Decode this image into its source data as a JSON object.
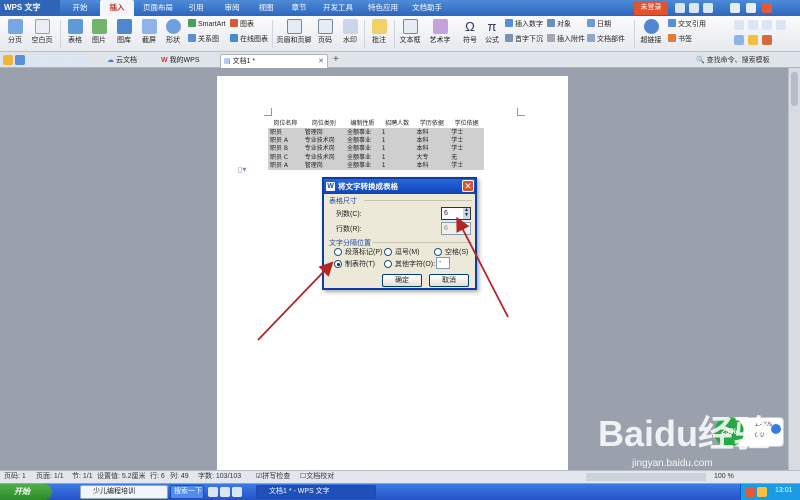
{
  "app": {
    "title": "WPS 文字",
    "login": "未登录"
  },
  "menu": [
    "开始",
    "插入",
    "页面布局",
    "引用",
    "审阅",
    "视图",
    "章节",
    "开发工具",
    "特色应用",
    "文档助手"
  ],
  "menu_active": "插入",
  "ribbon": {
    "page_break": "分页",
    "blank_page": "空白页",
    "table": "表格",
    "picture": "图片",
    "gallery": "图库",
    "screenshot": "截屏",
    "shape": "形状",
    "smartart": "SmartArt",
    "chart": "图表",
    "relation": "关系图",
    "online_chart": "在线图表",
    "header_footer": "页眉和页脚",
    "page_number": "页码",
    "watermark": "水印",
    "comment": "批注",
    "textbox": "文本框",
    "wordart": "艺术字",
    "symbol": "符号",
    "formula": "公式",
    "insert_number": "插入数字",
    "object": "对象",
    "first_drop": "首字下沉",
    "attach": "插入附件",
    "date": "日期",
    "doc_parts": "文档部件",
    "hyperlink": "超链接",
    "bookmark": "书签",
    "crossref": "交叉引用"
  },
  "tabs": {
    "cloud": "云文档",
    "my_wps": "我的WPS",
    "doc": "文档1 *",
    "search": "查找命令、搜索模板"
  },
  "doc_table": {
    "headers": [
      "岗位名称",
      "岗位类别",
      "编制性质",
      "招聘人数",
      "学历依据",
      "学位依据"
    ],
    "rows": [
      [
        "职员",
        "管理岗",
        "全额事业",
        "1",
        "本科",
        "学士"
      ],
      [
        "职员 A",
        "专业技术岗",
        "全额事业",
        "1",
        "本科",
        "学士"
      ],
      [
        "职员 B",
        "专业技术岗",
        "全额事业",
        "1",
        "本科",
        "学士"
      ],
      [
        "职员 C",
        "专业技术岗",
        "全额事业",
        "1",
        "大专",
        "无"
      ],
      [
        "职员 A",
        "管理岗",
        "全额事业",
        "1",
        "本科",
        "学士"
      ]
    ]
  },
  "dialog": {
    "title": "将文字转换成表格",
    "size_group": "表格尺寸",
    "cols_label": "列数(C):",
    "cols_value": "6",
    "rows_label": "行数(R):",
    "rows_value": "6",
    "sep_group": "文字分隔位置",
    "opt_para": "段落标记(P)",
    "opt_comma": "逗号(M)",
    "opt_space": "空格(S)",
    "opt_tab": "制表符(T)",
    "opt_other": "其他字符(O):",
    "other_value": "-",
    "ok": "确定",
    "cancel": "取消",
    "selected_option": "opt_tab"
  },
  "status": {
    "pages": "页码: 1",
    "page_of": "页面: 1/1",
    "section": "节: 1/1",
    "position": "设置值: 5.2厘米",
    "row": "行: 6",
    "col": "列: 49",
    "chars": "字数: 103/103",
    "spell": "拼写检查",
    "proof": "文档校对",
    "zoom": "100 %"
  },
  "taskbar": {
    "start": "开始",
    "item1": "少儿编程培训",
    "item2": "搜索一下",
    "item3": "文档1 * - WPS 文字",
    "clock": "13:01"
  },
  "speed": {
    "percent": "25%",
    "up": "1.4K/s",
    "down": "0K/s"
  },
  "watermark": {
    "main": "Baidu经验",
    "sub": "jingyan.baidu.com"
  },
  "colors": {
    "accent": "#2d67bd",
    "dialog_title": "#0d45b8",
    "arrow": "#b02525",
    "login": "#e0532f"
  }
}
